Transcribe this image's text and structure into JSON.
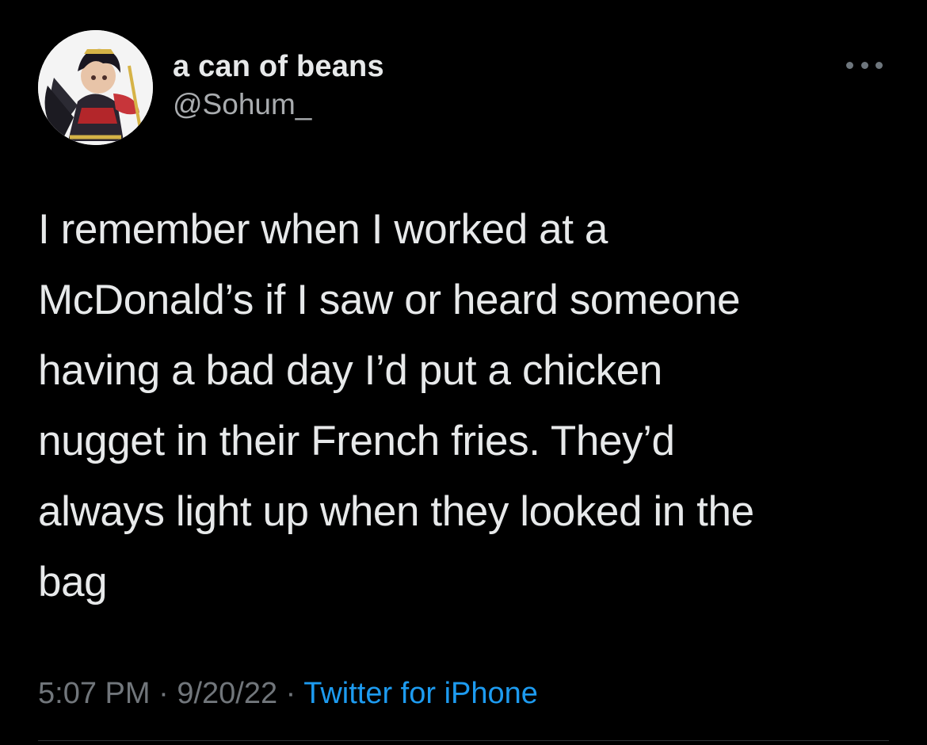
{
  "tweet": {
    "author": {
      "display_name": "a can of beans",
      "handle": "@Sohum_",
      "avatar_icon": "game-character-avatar"
    },
    "more_icon": "more-horizontal-icon",
    "text_lines": [
      "I remember when I worked at a",
      "McDonald’s if I saw or heard someone",
      "having a bad day I’d put a chicken",
      "nugget in their French fries. They’d",
      "always light up when they looked in the",
      "bag"
    ],
    "time": "5:07 PM",
    "separator": "·",
    "date": "9/20/22",
    "source": "Twitter for iPhone"
  },
  "colors": {
    "background": "#000000",
    "text": "#e7e9ea",
    "secondary": "#71767b",
    "link": "#1d9bf0"
  }
}
